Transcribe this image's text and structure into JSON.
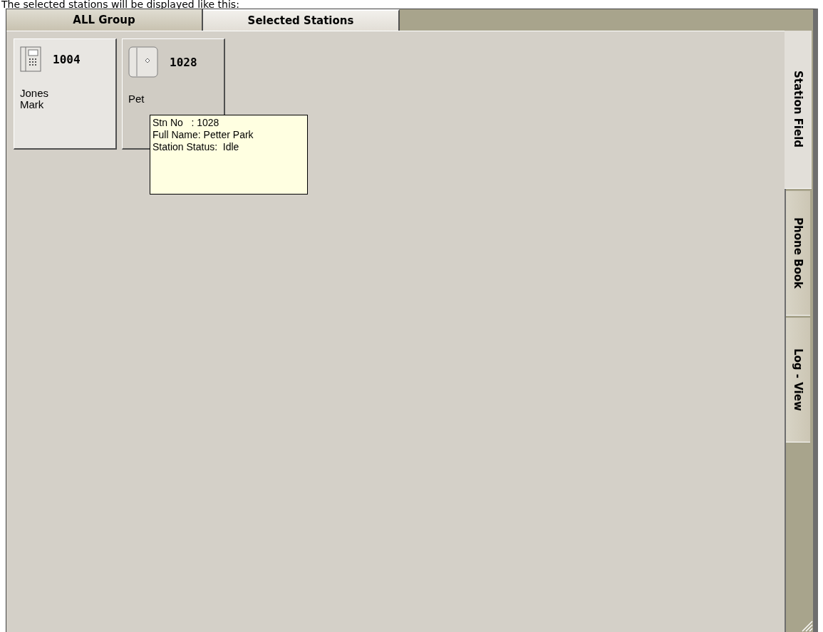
{
  "caption": "The selected stations will be displayed like this:",
  "top_tabs": [
    {
      "label": "ALL Group",
      "selected": false
    },
    {
      "label": "Selected Stations",
      "selected": true
    }
  ],
  "stations": [
    {
      "kind": "keypad",
      "number": "1004",
      "name": "Jones\nMark",
      "selected": false
    },
    {
      "kind": "console",
      "number": "1028",
      "name": "Pet",
      "selected": true
    }
  ],
  "tooltip": {
    "lines": [
      "Stn No   : 1028",
      "Full Name: Petter Park",
      "Station Status:  Idle"
    ]
  },
  "side_tabs": [
    {
      "label": "Station Field",
      "selected": true
    },
    {
      "label": "Phone Book",
      "selected": false
    },
    {
      "label": "Log - View",
      "selected": false
    }
  ]
}
